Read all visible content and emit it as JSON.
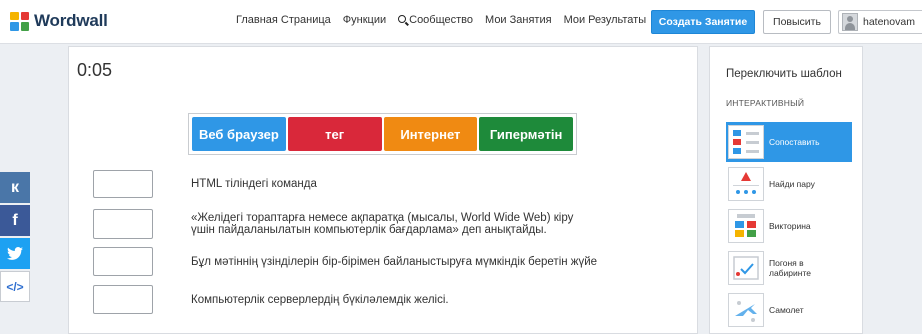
{
  "header": {
    "logo": "Wordwall",
    "nav": [
      {
        "label": "Главная Страница"
      },
      {
        "label": "Функции"
      },
      {
        "label": "Сообщество",
        "icon": "search-icon"
      },
      {
        "label": "Мои Занятия"
      },
      {
        "label": "Мои Результаты"
      }
    ],
    "create_label": "Создать Занятие",
    "upgrade_label": "Повысить",
    "username": "hatenovam"
  },
  "social": [
    {
      "label": "к",
      "icon": "vk-icon",
      "color": "#4a76a8"
    },
    {
      "label": "f",
      "icon": "facebook-icon",
      "color": "#3b5998"
    },
    {
      "label": "✈",
      "icon": "twitter-icon",
      "color": "#1da1f2"
    },
    {
      "label": "</>",
      "icon": "embed-icon",
      "color": "#ffffff"
    }
  ],
  "game": {
    "timer": "0:05",
    "answers": [
      {
        "label": "Веб браузер",
        "color": "#2f97e6"
      },
      {
        "label": "тег",
        "color": "#d9283a"
      },
      {
        "label": "Интернет",
        "color": "#f08a12"
      },
      {
        "label": "Гипермәтін",
        "color": "#1e8a3a"
      }
    ],
    "definitions": [
      {
        "lines": [
          "HTML тіліндегі команда"
        ]
      },
      {
        "lines": [
          "«Желідегі тораптарға немесе ақпаратқа (мысалы, World Wide Web) кіру",
          "үшін пайдаланылатын компьютерлік бағдарлама» деп анықтайды."
        ]
      },
      {
        "lines": [
          "Бұл мәтіннің үзінділерін бір-бірімен байланыстыруға мүмкіндік беретін жүйе"
        ]
      },
      {
        "lines": [
          "Компьютерлік серверлердің бүкіләлемдік желісі."
        ]
      }
    ]
  },
  "templates": {
    "title": "Переключить шаблон",
    "section": "ИНТЕРАКТИВНЫЙ",
    "items": [
      {
        "label": "Сопоставить",
        "icon": "match-up-icon",
        "active": true
      },
      {
        "label": "Найди пару",
        "icon": "find-match-icon",
        "active": false
      },
      {
        "label": "Викторина",
        "icon": "quiz-icon",
        "active": false
      },
      {
        "label": "Погоня в\nлабиринте",
        "icon": "maze-chase-icon",
        "active": false
      },
      {
        "label": "Самолет",
        "icon": "airplane-icon",
        "active": false
      }
    ]
  },
  "colors": {
    "brand_blue": "#2f97e6",
    "logo_squares": [
      "#f5b400",
      "#e53935",
      "#2f97e6",
      "#43a047"
    ]
  }
}
